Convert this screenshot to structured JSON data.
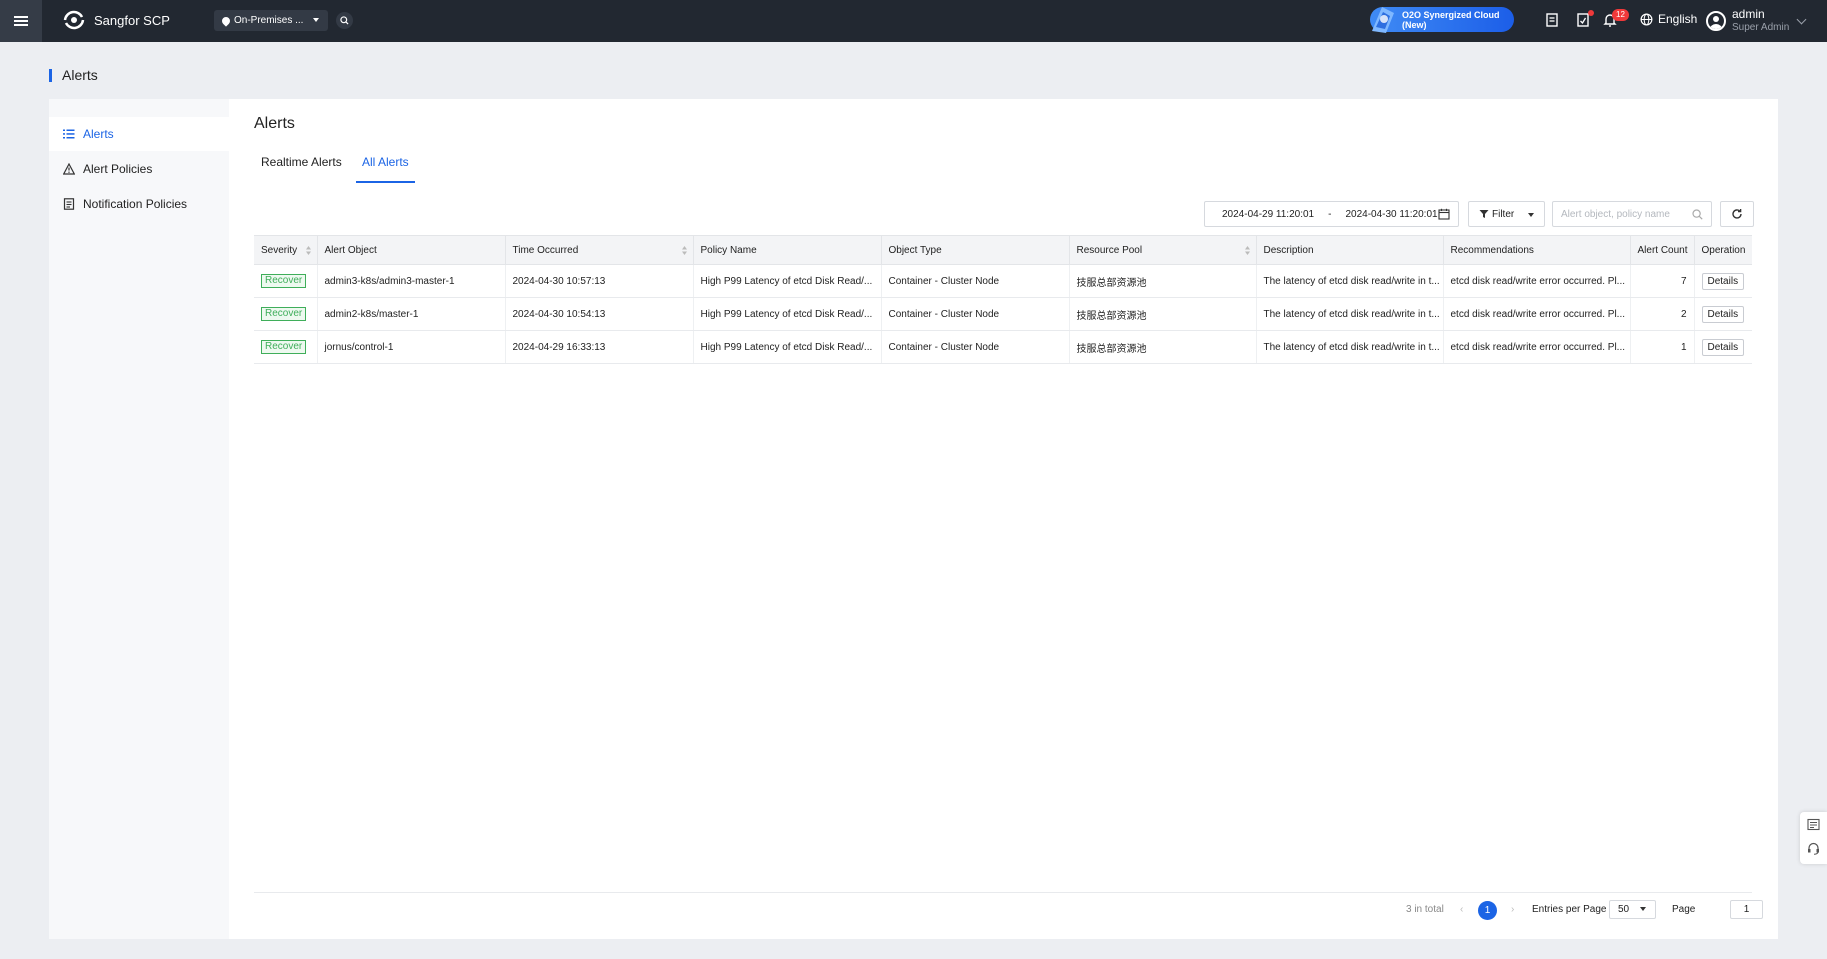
{
  "app": {
    "name": "Sangfor SCP",
    "location": "On-Premises ...",
    "o2o_label": "O2O Synergized Cloud (New)",
    "notification_count": "12",
    "language": "English",
    "user_name": "admin",
    "user_role": "Super Admin"
  },
  "page": {
    "heading": "Alerts",
    "title": "Alerts"
  },
  "sidebar": {
    "items": [
      {
        "label": "Alerts",
        "icon": "list-icon"
      },
      {
        "label": "Alert Policies",
        "icon": "warning-triangle-icon"
      },
      {
        "label": "Notification Policies",
        "icon": "document-icon"
      }
    ]
  },
  "tabs": [
    {
      "label": "Realtime Alerts"
    },
    {
      "label": "All Alerts"
    }
  ],
  "toolbar": {
    "date_from": "2024-04-29 11:20:01",
    "date_sep": "-",
    "date_to": "2024-04-30 11:20:01",
    "filter_label": "Filter",
    "search_placeholder": "Alert object, policy name"
  },
  "table": {
    "headers": [
      "Severity",
      "Alert Object",
      "Time Occurred",
      "Policy Name",
      "Object Type",
      "Resource Pool",
      "Description",
      "Recommendations",
      "Alert Count",
      "Operation"
    ],
    "rows": [
      {
        "severity": "Recover",
        "object": "admin3-k8s/admin3-master-1",
        "time": "2024-04-30 10:57:13",
        "policy": "High P99 Latency of etcd Disk Read/...",
        "type": "Container - Cluster Node",
        "pool": "技服总部资源池",
        "desc": "The latency of etcd disk read/write in t...",
        "rec": "etcd disk read/write error occurred. Pl...",
        "count": "7",
        "op": "Details"
      },
      {
        "severity": "Recover",
        "object": "admin2-k8s/master-1",
        "time": "2024-04-30 10:54:13",
        "policy": "High P99 Latency of etcd Disk Read/...",
        "type": "Container - Cluster Node",
        "pool": "技服总部资源池",
        "desc": "The latency of etcd disk read/write in t...",
        "rec": "etcd disk read/write error occurred. Pl...",
        "count": "2",
        "op": "Details"
      },
      {
        "severity": "Recover",
        "object": "jornus/control-1",
        "time": "2024-04-29 16:33:13",
        "policy": "High P99 Latency of etcd Disk Read/...",
        "type": "Container - Cluster Node",
        "pool": "技服总部资源池",
        "desc": "The latency of etcd disk read/write in t...",
        "rec": "etcd disk read/write error occurred. Pl...",
        "count": "1",
        "op": "Details"
      }
    ]
  },
  "pager": {
    "total": "3 in total",
    "prev": "‹",
    "current_page": "1",
    "next": "›",
    "entries_label": "Entries per Page",
    "entries_value": "50",
    "page_label": "Page",
    "page_value": "1"
  },
  "colors": {
    "accent": "#1b64e5",
    "topbar": "#222831",
    "recover_green": "#3fae5a",
    "badge_red": "#f0393a"
  }
}
